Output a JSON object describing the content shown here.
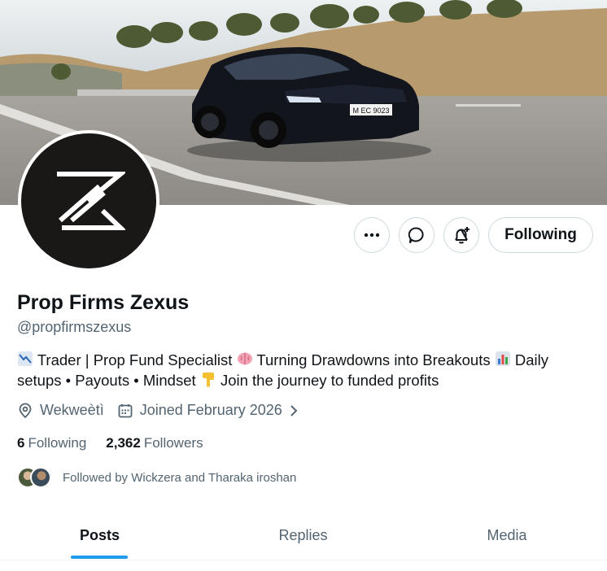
{
  "profile": {
    "name": "Prop Firms Zexus",
    "handle": "@propfirmszexus",
    "bio": {
      "p1": "Trader | Prop Fund Specialist",
      "p2": "Turning Drawdowns into Breakouts",
      "p3": "Daily setups • Payouts • Mindset",
      "p4": "Join the journey to funded profits"
    },
    "location": "Wekweètì",
    "joined": "Joined February 2026"
  },
  "banner": {
    "plate": "M EC 9023"
  },
  "actions": {
    "follow_label": "Following"
  },
  "stats": {
    "following_count": "6",
    "following_label": "Following",
    "followers_count": "2,362",
    "followers_label": "Followers"
  },
  "followed_by": "Followed by Wickzera and Tharaka iroshan",
  "tabs": {
    "posts": "Posts",
    "replies": "Replies",
    "media": "Media"
  },
  "colors": {
    "accent": "#1d9bf0",
    "text": "#0f1419",
    "muted": "#536471",
    "avatar_bg": "#1a1717"
  },
  "icons": [
    "more-icon",
    "message-icon",
    "notify-icon",
    "location-icon",
    "calendar-icon",
    "chevron-right-icon",
    "chart-down-icon",
    "brain-icon",
    "bar-chart-icon",
    "pointing-down-icon"
  ]
}
